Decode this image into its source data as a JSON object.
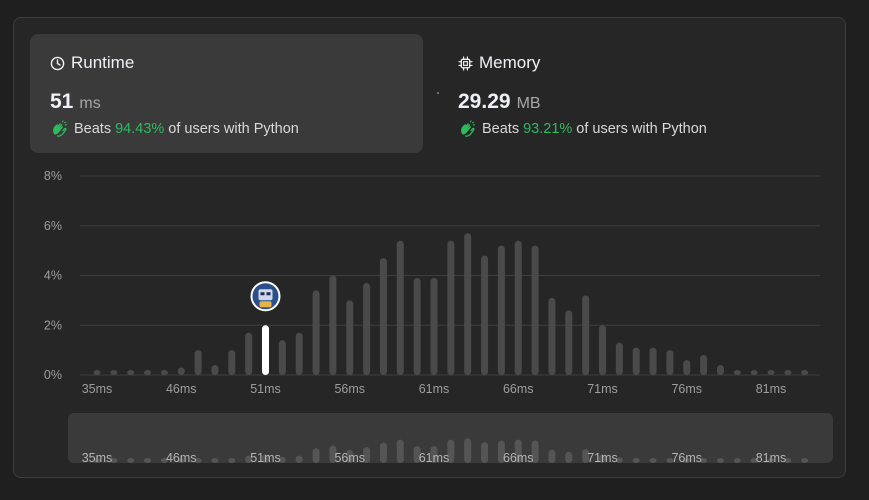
{
  "runtime": {
    "title": "Runtime",
    "value": "51",
    "unit": "ms",
    "beats_label": "Beats",
    "percent": "94.43%",
    "suffix": "of users with Python"
  },
  "memory": {
    "title": "Memory",
    "value": "29.29",
    "unit": "MB",
    "beats_label": "Beats",
    "percent": "93.21%",
    "suffix": "of users with Python"
  },
  "colors": {
    "accent_green": "#2cbb5d",
    "bar": "#4a4a4a",
    "highlight_bar": "#ffffff",
    "grid": "#3e3e3e",
    "label": "#9e9e9e"
  },
  "icons": {
    "runtime": "clock-icon",
    "memory": "chip-icon",
    "beats": "clapping-hands-icon",
    "marker": "avatar"
  },
  "chart_data": {
    "type": "bar",
    "ylim": [
      0,
      8
    ],
    "yticks": [
      "0%",
      "2%",
      "4%",
      "6%",
      "8%"
    ],
    "xticks": [
      "35ms",
      "46ms",
      "51ms",
      "56ms",
      "61ms",
      "66ms",
      "71ms",
      "76ms",
      "81ms"
    ],
    "values": [
      0.2,
      0.2,
      0.2,
      0.2,
      0.2,
      0.3,
      1.0,
      0.4,
      1.0,
      1.7,
      2.0,
      1.4,
      1.7,
      3.4,
      4.0,
      3.0,
      3.7,
      4.7,
      5.4,
      3.9,
      3.9,
      5.4,
      5.7,
      4.8,
      5.2,
      5.4,
      5.2,
      3.1,
      2.6,
      3.2,
      2.0,
      1.3,
      1.1,
      1.1,
      1.0,
      0.6,
      0.8,
      0.4,
      0.2,
      0.2,
      0.2,
      0.2,
      0.2
    ],
    "highlight_index": 10
  }
}
